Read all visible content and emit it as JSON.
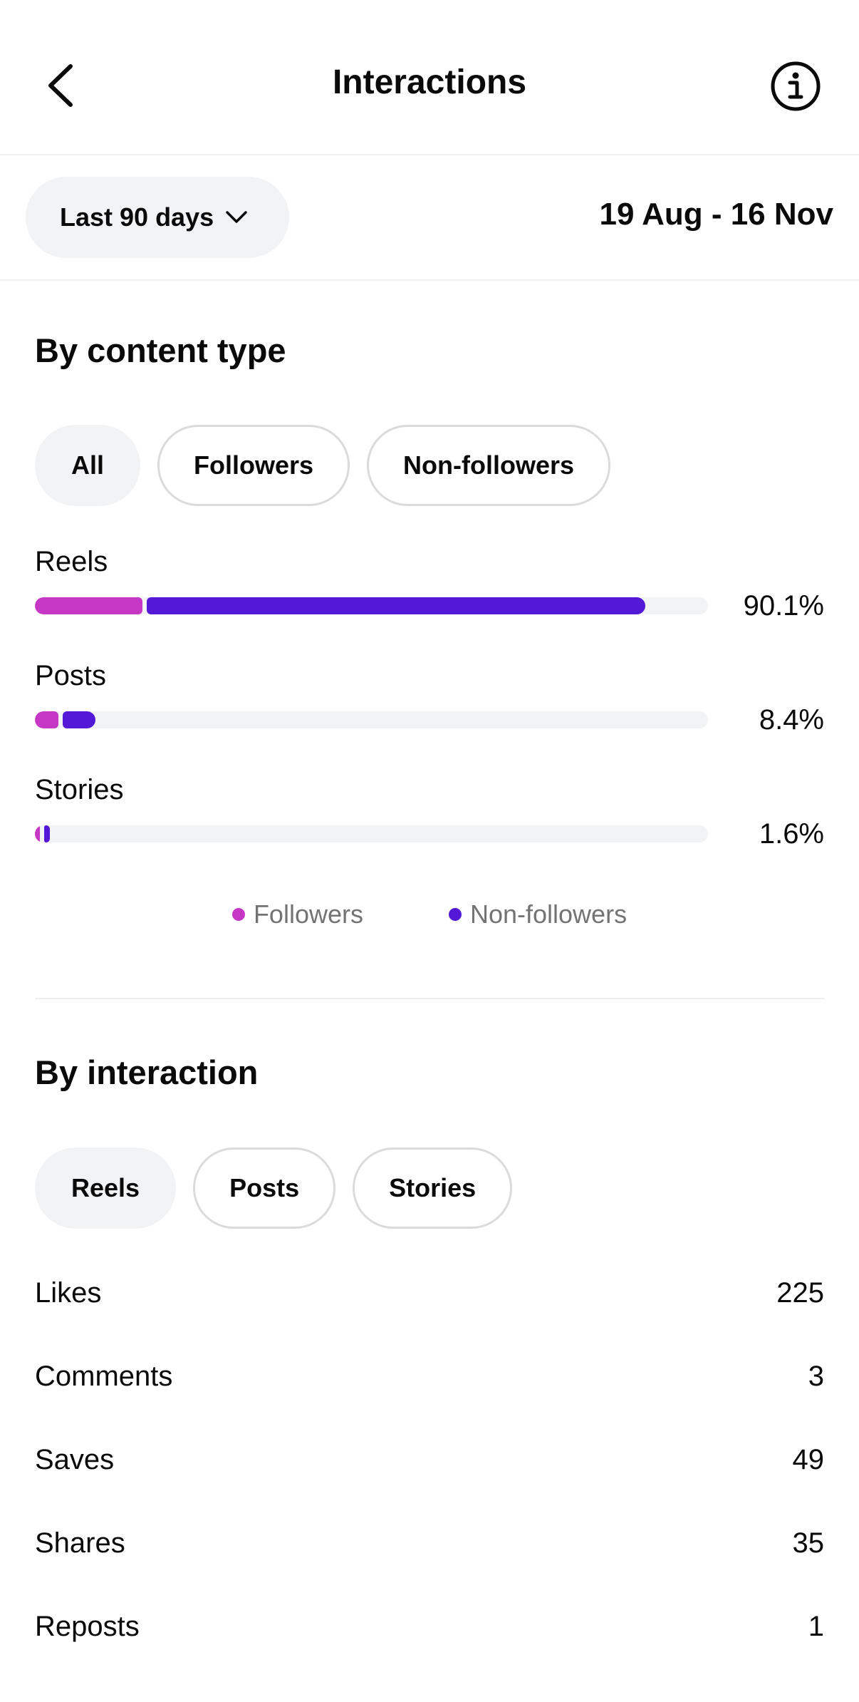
{
  "header": {
    "title": "Interactions",
    "back_icon": "chevron-left-icon",
    "info_icon": "info-circle-icon"
  },
  "filter": {
    "range_label": "Last 90 days",
    "range_icon": "chevron-down-icon",
    "date_range": "19 Aug - 16 Nov"
  },
  "content_type": {
    "title": "By content type",
    "chips": [
      {
        "label": "All",
        "active": true
      },
      {
        "label": "Followers",
        "active": false
      },
      {
        "label": "Non-followers",
        "active": false
      }
    ],
    "bars": [
      {
        "label": "Reels",
        "percent": "90.1%",
        "followers_share": 0.16,
        "non_followers_share": 0.741
      },
      {
        "label": "Posts",
        "percent": "8.4%",
        "followers_share": 0.035,
        "non_followers_share": 0.049
      },
      {
        "label": "Stories",
        "percent": "1.6%",
        "followers_share": 0.007,
        "non_followers_share": 0.009
      }
    ],
    "legend": [
      {
        "label": "Followers",
        "color": "#c737c6"
      },
      {
        "label": "Non-followers",
        "color": "#5419d6"
      }
    ]
  },
  "interaction": {
    "title": "By interaction",
    "chips": [
      {
        "label": "Reels",
        "active": true
      },
      {
        "label": "Posts",
        "active": false
      },
      {
        "label": "Stories",
        "active": false
      }
    ],
    "rows": [
      {
        "label": "Likes",
        "value": "225"
      },
      {
        "label": "Comments",
        "value": "3"
      },
      {
        "label": "Saves",
        "value": "49"
      },
      {
        "label": "Shares",
        "value": "35"
      },
      {
        "label": "Reposts",
        "value": "1"
      }
    ]
  },
  "colors": {
    "followers": "#c737c6",
    "non_followers": "#5419d6",
    "track": "#f2f3f5"
  }
}
